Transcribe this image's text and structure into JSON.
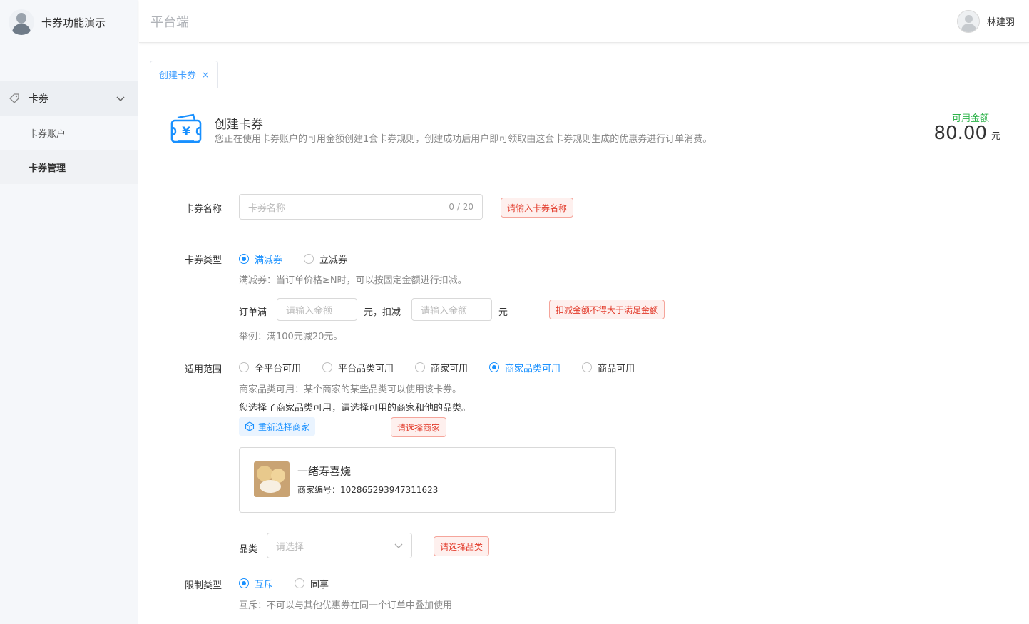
{
  "sidebar": {
    "brand_title": "卡券功能演示",
    "menu": {
      "parent_label": "卡券",
      "children": [
        {
          "label": "卡券账户"
        },
        {
          "label": "卡券管理"
        }
      ]
    }
  },
  "header": {
    "title": "平台端",
    "user_name": "林建羽"
  },
  "tabs": [
    {
      "label": "创建卡券",
      "close": "×"
    }
  ],
  "intro": {
    "title": "创建卡券",
    "description": "您正在使用卡券账户的可用金额创建1套卡券规则，创建成功后用户即可领取由这套卡券规则生成的优惠券进行订单消费。",
    "balance_label": "可用金额",
    "balance_value": "80.00",
    "balance_unit": "元"
  },
  "form": {
    "name": {
      "label": "卡券名称",
      "placeholder": "卡券名称",
      "count": "0 / 20",
      "error": "请输入卡券名称"
    },
    "type": {
      "label": "卡券类型",
      "options": [
        "满减券",
        "立减券"
      ],
      "selected": "满减券",
      "hint": "满减券：当订单价格≥N时，可以按固定金额进行扣减。",
      "order_full_label": "订单满",
      "amount_placeholder": "请输入金额",
      "unit_deduct": "元，扣减",
      "deduct_placeholder": "请输入金额",
      "unit": "元",
      "error": "扣减金额不得大于满足金额",
      "example": "举例：满100元减20元。"
    },
    "scope": {
      "label": "适用范围",
      "options": [
        "全平台可用",
        "平台品类可用",
        "商家可用",
        "商家品类可用",
        "商品可用"
      ],
      "selected": "商家品类可用",
      "hint": "商家品类可用：某个商家的某些品类可以使用该卡券。",
      "notice": "您选择了商家品类可用，请选择可用的商家和他的品类。",
      "reselect_button": "重新选择商家",
      "merchant_error": "请选择商家",
      "merchant": {
        "name": "一绪寿喜烧",
        "id_text": "商家编号：102865293947311623"
      },
      "category_label": "品类",
      "category_placeholder": "请选择",
      "category_error": "请选择品类"
    },
    "limit": {
      "label": "限制类型",
      "options": [
        "互斥",
        "同享"
      ],
      "selected": "互斥",
      "hint": "互斥：不可以与其他优惠券在同一个订单中叠加使用"
    }
  },
  "colors": {
    "primary": "#1890ff",
    "success": "#2db34a",
    "error": "#e23a2a"
  }
}
